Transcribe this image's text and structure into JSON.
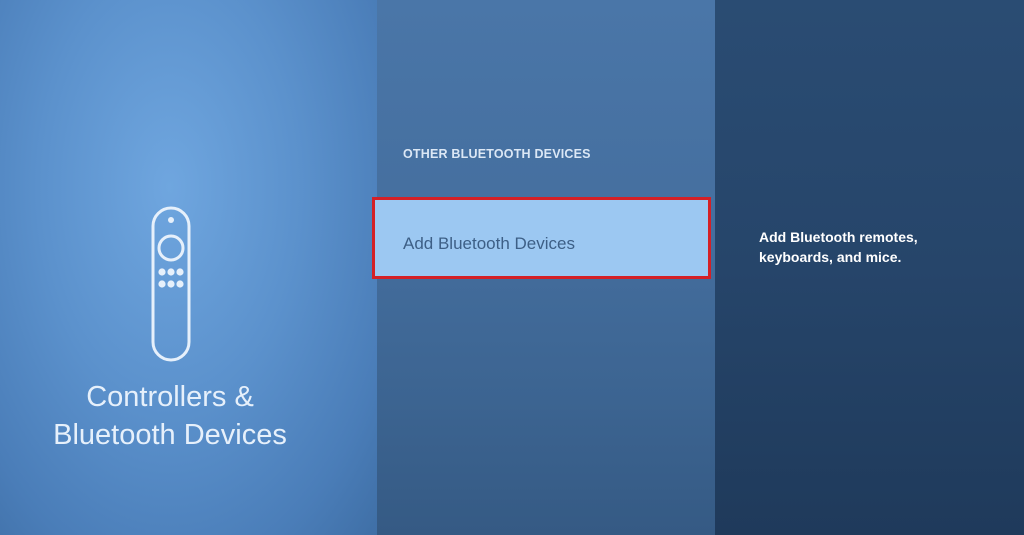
{
  "left_panel": {
    "icon": "remote-control-icon",
    "title_line1": "Controllers &",
    "title_line2": "Bluetooth Devices"
  },
  "middle_panel": {
    "section_header": "OTHER BLUETOOTH DEVICES",
    "items": [
      {
        "label": "Add Bluetooth Devices",
        "selected": true
      }
    ]
  },
  "right_panel": {
    "description": "Add Bluetooth remotes, keyboards, and mice."
  },
  "colors": {
    "highlight_border": "#d42026",
    "selected_item_bg": "#9cc8f2",
    "selected_item_text": "#3d5f86"
  }
}
